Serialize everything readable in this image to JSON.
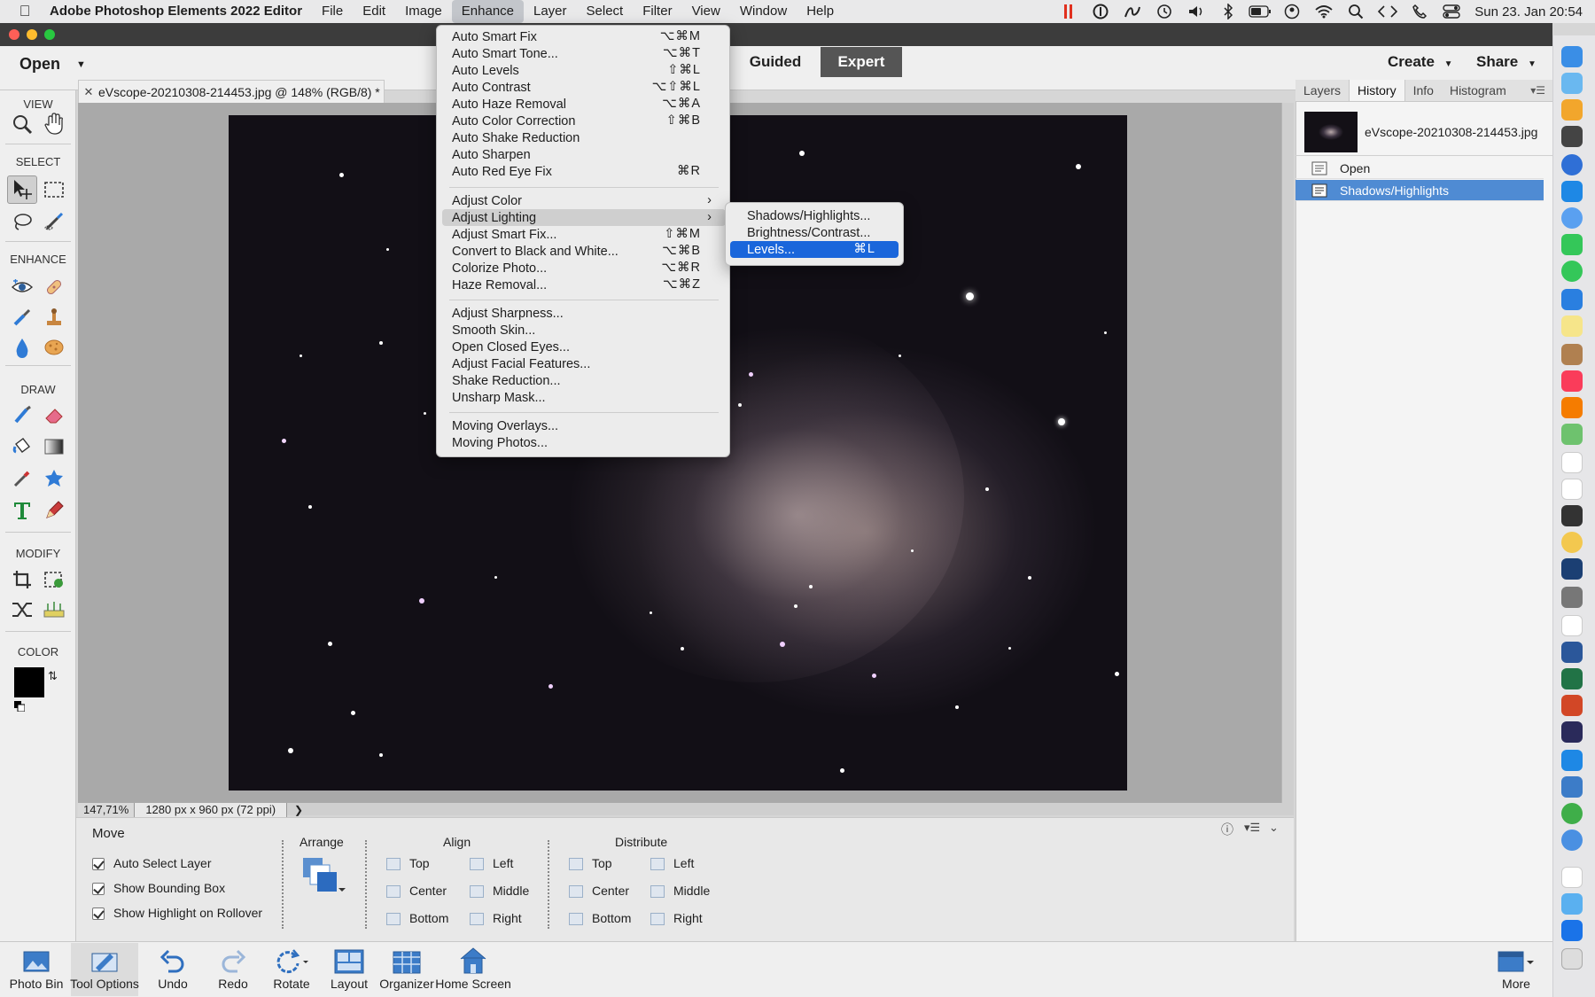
{
  "menubar": {
    "app_name": "Adobe Photoshop Elements 2022 Editor",
    "items": [
      "File",
      "Edit",
      "Image",
      "Enhance",
      "Layer",
      "Select",
      "Filter",
      "View",
      "Window",
      "Help"
    ],
    "clock": "Sun 23. Jan  20:54"
  },
  "header": {
    "open_label": "Open",
    "mode_guided": "Guided",
    "mode_expert": "Expert",
    "create_label": "Create",
    "share_label": "Share"
  },
  "toolbox": {
    "sections": [
      "VIEW",
      "SELECT",
      "ENHANCE",
      "DRAW",
      "MODIFY",
      "COLOR"
    ]
  },
  "document": {
    "tab_title": "eVscope-20210308-214453.jpg @ 148% (RGB/8) *",
    "zoom": "147,71%",
    "dimensions": "1280 px x 960 px (72 ppi)"
  },
  "right_panel": {
    "tabs": [
      "Layers",
      "History",
      "Info",
      "Histogram"
    ],
    "active_tab": "History",
    "file_name": "eVscope-20210308-214453.jpg",
    "history": [
      "Open",
      "Shadows/Highlights"
    ]
  },
  "enhance_menu": {
    "group1": [
      {
        "label": "Auto Smart Fix",
        "shortcut": "⌥⌘M"
      },
      {
        "label": "Auto Smart Tone...",
        "shortcut": "⌥⌘T"
      },
      {
        "label": "Auto Levels",
        "shortcut": "⇧⌘L"
      },
      {
        "label": "Auto Contrast",
        "shortcut": "⌥⇧⌘L"
      },
      {
        "label": "Auto Haze Removal",
        "shortcut": "⌥⌘A"
      },
      {
        "label": "Auto Color Correction",
        "shortcut": "⇧⌘B"
      },
      {
        "label": "Auto Shake Reduction",
        "shortcut": ""
      },
      {
        "label": "Auto Sharpen",
        "shortcut": ""
      },
      {
        "label": "Auto Red Eye Fix",
        "shortcut": "⌘R"
      }
    ],
    "group2": [
      {
        "label": "Adjust Color",
        "shortcut": ""
      },
      {
        "label": "Adjust Lighting",
        "shortcut": ""
      },
      {
        "label": "Adjust Smart Fix...",
        "shortcut": "⇧⌘M"
      },
      {
        "label": "Convert to Black and White...",
        "shortcut": "⌥⌘B"
      },
      {
        "label": "Colorize Photo...",
        "shortcut": "⌥⌘R"
      },
      {
        "label": "Haze Removal...",
        "shortcut": "⌥⌘Z"
      }
    ],
    "group3": [
      {
        "label": "Adjust Sharpness..."
      },
      {
        "label": "Smooth Skin..."
      },
      {
        "label": "Open Closed Eyes..."
      },
      {
        "label": "Adjust Facial Features..."
      },
      {
        "label": "Shake Reduction..."
      },
      {
        "label": "Unsharp Mask..."
      }
    ],
    "group4": [
      {
        "label": "Moving Overlays..."
      },
      {
        "label": "Moving Photos..."
      }
    ]
  },
  "lighting_submenu": [
    {
      "label": "Shadows/Highlights...",
      "shortcut": ""
    },
    {
      "label": "Brightness/Contrast...",
      "shortcut": ""
    },
    {
      "label": "Levels...",
      "shortcut": "⌘L"
    }
  ],
  "tool_options": {
    "tool_name": "Move",
    "checkboxes": [
      "Auto Select Layer",
      "Show Bounding Box",
      "Show Highlight on Rollover"
    ],
    "arrange_label": "Arrange",
    "align_label": "Align",
    "align_items": [
      "Top",
      "Center",
      "Bottom",
      "Left",
      "Middle",
      "Right"
    ],
    "distribute_label": "Distribute",
    "distribute_items": [
      "Top",
      "Center",
      "Bottom",
      "Left",
      "Middle",
      "Right"
    ]
  },
  "taskbar": {
    "items": [
      "Photo Bin",
      "Tool Options",
      "Undo",
      "Redo",
      "Rotate",
      "Layout",
      "Organizer",
      "Home Screen"
    ],
    "more_label": "More"
  },
  "colors": {
    "menu_highlight": "#1a66db",
    "history_selected": "#4f8bd3",
    "expert_bg": "#555555"
  }
}
